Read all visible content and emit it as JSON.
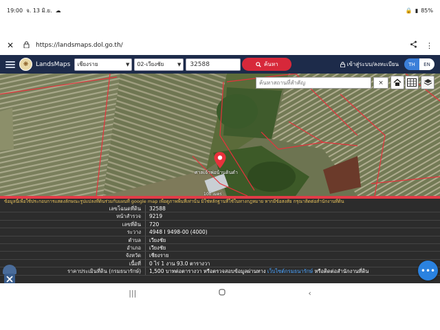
{
  "status": {
    "time": "19:00",
    "date": "จ. 13 มิ.ย.",
    "battery": "85%"
  },
  "browser": {
    "url": "https://landsmaps.dol.go.th/"
  },
  "header": {
    "brand": "LandsMaps",
    "province": "เชียงราย",
    "district": "02-เวียงชัย",
    "parcel_no": "32588",
    "search_label": "ค้นหา",
    "login_label": "เข้าสู่ระบบ/ลงทะเบียน",
    "lang_th": "TH",
    "lang_en": "EN"
  },
  "map": {
    "search_placeholder": "ค้นหาสถานที่สำคัญ",
    "clear": "×",
    "place_label": "ศาลเจ้าพ่อบ้านดินดำ",
    "scale_text": "100 เมตร"
  },
  "info": {
    "notice": "ข้อมูลนี้เพื่อใช้ประกอบการแสดงลักษณะรูปแปลงที่ดินร่วมกับแผนที่ google map เพื่อดูภาพพื้นที่เท่านั้น มิใช่หลักฐานที่ใช้ในทางกฎหมาย หากมีข้อสงสัย กรุณาติดต่อสำนักงานที่ดิน",
    "rows": [
      {
        "key": "เลขโฉนดที่ดิน",
        "value": "32588"
      },
      {
        "key": "หน้าสำรวจ",
        "value": "9219"
      },
      {
        "key": "เลขที่ดิน",
        "value": "720"
      },
      {
        "key": "ระวาง",
        "value": "4948 I 9498-00 (4000)"
      },
      {
        "key": "ตำบล",
        "value": "เวียงชัย"
      },
      {
        "key": "อำเภอ",
        "value": "เวียงชัย"
      },
      {
        "key": "จังหวัด",
        "value": "เชียงราย"
      },
      {
        "key": "เนื้อที่",
        "value": "0 ไร่ 1 งาน 93.0 ตารางวา"
      }
    ],
    "price_key": "ราคาประเมินที่ดิน (กรมธนารักษ์)",
    "price_prefix": "1,500 บาทต่อตารางวา หรือตรวจสอบข้อมูลผ่านทาง",
    "price_link": "เว็บไซต์กรมธนารักษ์",
    "price_suffix": "หรือติดต่อสำนักงานที่ดิน"
  },
  "colors": {
    "header_bg": "#1d2b4a",
    "search_button": "#d7283a",
    "lang_active": "#3b7fd9",
    "parcel_border": "#e8323c",
    "fab": "#2a82e0"
  }
}
